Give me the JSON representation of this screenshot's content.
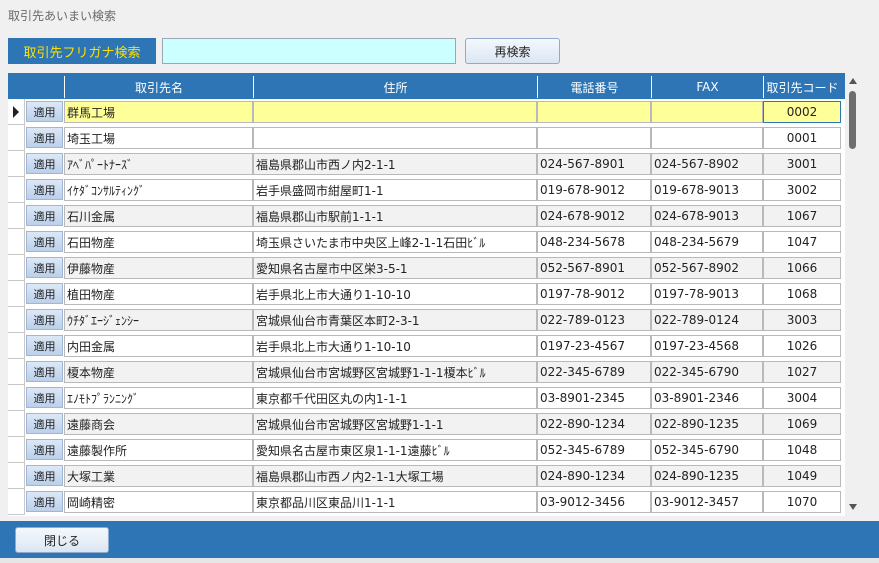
{
  "window": {
    "title": "取引先あいまい検索"
  },
  "search": {
    "label": "取引先フリガナ検索",
    "value": "",
    "button_label": "再検索"
  },
  "grid": {
    "columns": [
      "取引先名",
      "住所",
      "電話番号",
      "FAX",
      "取引先コード"
    ],
    "apply_label": "適用",
    "rows": [
      {
        "name": "群馬工場",
        "address": "",
        "phone": "",
        "fax": "",
        "code": "0002"
      },
      {
        "name": "埼玉工場",
        "address": "",
        "phone": "",
        "fax": "",
        "code": "0001"
      },
      {
        "name": "ｱﾍﾞﾊﾟｰﾄﾅｰｽﾞ",
        "address": "福島県郡山市西ノ内2-1-1",
        "phone": "024-567-8901",
        "fax": "024-567-8902",
        "code": "3001"
      },
      {
        "name": "ｲｹﾀﾞｺﾝｻﾙﾃｨﾝｸﾞ",
        "address": "岩手県盛岡市紺屋町1-1",
        "phone": "019-678-9012",
        "fax": "019-678-9013",
        "code": "3002"
      },
      {
        "name": "石川金属",
        "address": "福島県郡山市駅前1-1-1",
        "phone": "024-678-9012",
        "fax": "024-678-9013",
        "code": "1067"
      },
      {
        "name": "石田物産",
        "address": "埼玉県さいたま市中央区上峰2-1-1石田ﾋﾞﾙ",
        "phone": "048-234-5678",
        "fax": "048-234-5679",
        "code": "1047"
      },
      {
        "name": "伊藤物産",
        "address": "愛知県名古屋市中区栄3-5-1",
        "phone": "052-567-8901",
        "fax": "052-567-8902",
        "code": "1066"
      },
      {
        "name": "植田物産",
        "address": "岩手県北上市大通り1-10-10",
        "phone": "0197-78-9012",
        "fax": "0197-78-9013",
        "code": "1068"
      },
      {
        "name": "ｳﾁﾀﾞｴｰｼﾞｪﾝｼｰ",
        "address": "宮城県仙台市青葉区本町2-3-1",
        "phone": "022-789-0123",
        "fax": "022-789-0124",
        "code": "3003"
      },
      {
        "name": "内田金属",
        "address": "岩手県北上市大通り1-10-10",
        "phone": "0197-23-4567",
        "fax": "0197-23-4568",
        "code": "1026"
      },
      {
        "name": "榎本物産",
        "address": "宮城県仙台市宮城野区宮城野1-1-1榎本ﾋﾞﾙ",
        "phone": "022-345-6789",
        "fax": "022-345-6790",
        "code": "1027"
      },
      {
        "name": "ｴﾉﾓﾄﾌﾟﾗﾝﾆﾝｸﾞ",
        "address": "東京都千代田区丸の内1-1-1",
        "phone": "03-8901-2345",
        "fax": "03-8901-2346",
        "code": "3004"
      },
      {
        "name": "遠藤商会",
        "address": "宮城県仙台市宮城野区宮城野1-1-1",
        "phone": "022-890-1234",
        "fax": "022-890-1235",
        "code": "1069"
      },
      {
        "name": "遠藤製作所",
        "address": "愛知県名古屋市東区泉1-1-1遠藤ﾋﾞﾙ",
        "phone": "052-345-6789",
        "fax": "052-345-6790",
        "code": "1048"
      },
      {
        "name": "大塚工業",
        "address": "福島県郡山市西ノ内2-1-1大塚工場",
        "phone": "024-890-1234",
        "fax": "024-890-1235",
        "code": "1049"
      },
      {
        "name": "岡崎精密",
        "address": "東京都品川区東品川1-1-1",
        "phone": "03-9012-3456",
        "fax": "03-9012-3457",
        "code": "1070"
      }
    ]
  },
  "footer": {
    "close_label": "閉じる"
  },
  "colors": {
    "accent": "#2e75b6",
    "label_text": "#ffe100",
    "input_bg": "#ccffff",
    "current_row": "#ffff99"
  }
}
